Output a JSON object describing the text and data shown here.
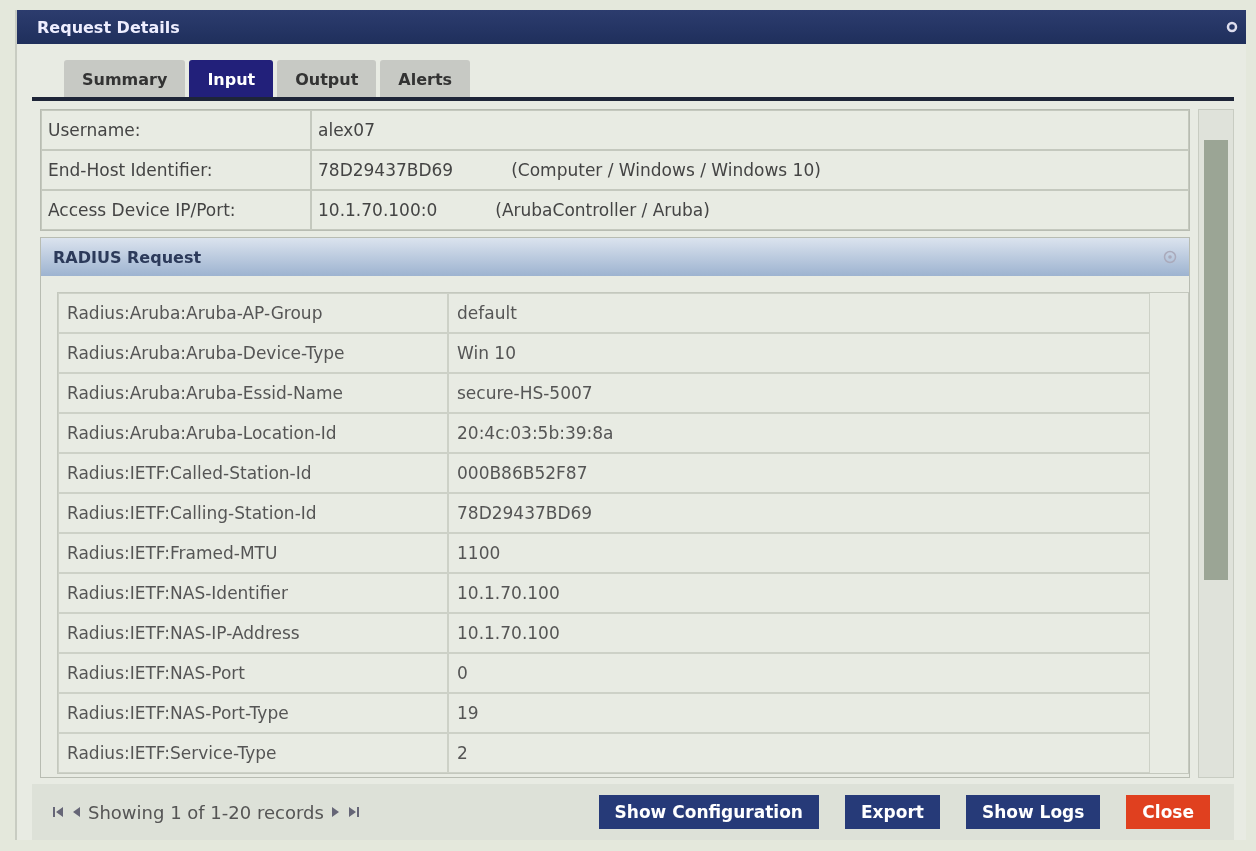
{
  "window": {
    "title": "Request Details"
  },
  "tabs": [
    {
      "label": "Summary",
      "selected": false
    },
    {
      "label": "Input",
      "selected": true
    },
    {
      "label": "Output",
      "selected": false
    },
    {
      "label": "Alerts",
      "selected": false
    }
  ],
  "info": [
    {
      "label": "Username:",
      "value": "alex07"
    },
    {
      "label": "End-Host Identifier:",
      "value": "78D29437BD69",
      "detail": "(Computer / Windows / Windows 10)"
    },
    {
      "label": "Access Device IP/Port:",
      "value": "10.1.70.100:0",
      "detail": "(ArubaController / Aruba)"
    }
  ],
  "radius": {
    "title": "RADIUS Request",
    "rows": [
      {
        "attribute": "Radius:Aruba:Aruba-AP-Group",
        "value": "default"
      },
      {
        "attribute": "Radius:Aruba:Aruba-Device-Type",
        "value": "Win 10"
      },
      {
        "attribute": "Radius:Aruba:Aruba-Essid-Name",
        "value": "secure-HS-5007"
      },
      {
        "attribute": "Radius:Aruba:Aruba-Location-Id",
        "value": "20:4c:03:5b:39:8a"
      },
      {
        "attribute": "Radius:IETF:Called-Station-Id",
        "value": "000B86B52F87"
      },
      {
        "attribute": "Radius:IETF:Calling-Station-Id",
        "value": "78D29437BD69"
      },
      {
        "attribute": "Radius:IETF:Framed-MTU",
        "value": "1100"
      },
      {
        "attribute": "Radius:IETF:NAS-Identifier",
        "value": "10.1.70.100"
      },
      {
        "attribute": "Radius:IETF:NAS-IP-Address",
        "value": "10.1.70.100"
      },
      {
        "attribute": "Radius:IETF:NAS-Port",
        "value": "0"
      },
      {
        "attribute": "Radius:IETF:NAS-Port-Type",
        "value": "19"
      },
      {
        "attribute": "Radius:IETF:Service-Type",
        "value": "2"
      }
    ]
  },
  "footer": {
    "pager": "Showing 1 of 1-20 records",
    "buttons": [
      {
        "label": "Show Configuration",
        "kind": "primary"
      },
      {
        "label": "Export",
        "kind": "primary"
      },
      {
        "label": "Show Logs",
        "kind": "primary"
      },
      {
        "label": "Close",
        "kind": "danger"
      }
    ]
  }
}
